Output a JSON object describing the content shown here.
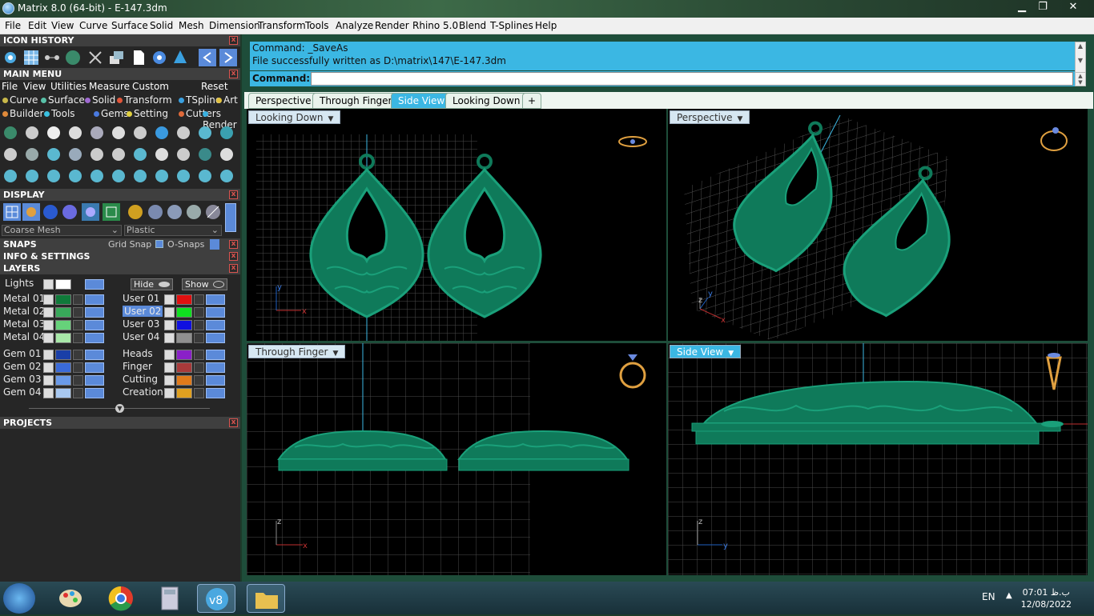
{
  "window": {
    "title": "Matrix 8.0 (64-bit) - E-147.3dm",
    "min": "▁",
    "max": "❐",
    "close": "✕"
  },
  "menubar": [
    "File",
    "Edit",
    "View",
    "Curve",
    "Surface",
    "Solid",
    "Mesh",
    "Dimension",
    "Transform",
    "Tools",
    "Analyze",
    "Render",
    "Rhino 5.0",
    "Blend",
    "T-Splines",
    "Help"
  ],
  "panels": {
    "icon_history": "ICON HISTORY",
    "main_menu": "MAIN MENU",
    "display": "DISPLAY",
    "snaps": "SNAPS",
    "info": "INFO & SETTINGS",
    "layers": "LAYERS",
    "projects": "PROJECTS"
  },
  "main_menu_tabs": [
    "File",
    "View",
    "Utilities",
    "Measure",
    "Custom",
    "Reset"
  ],
  "categories_row1": [
    {
      "label": "Curve",
      "color": "#c8b84a"
    },
    {
      "label": "Surface",
      "color": "#58c0a8"
    },
    {
      "label": "Solid",
      "color": "#9f6ad1"
    },
    {
      "label": "Transform",
      "color": "#e0553a"
    },
    {
      "label": "TSpline",
      "color": "#3aa0e0"
    },
    {
      "label": "Art",
      "color": "#e0c040"
    }
  ],
  "categories_row2": [
    {
      "label": "Builder",
      "color": "#e08a3a"
    },
    {
      "label": "Tools",
      "color": "#3ac0e0"
    },
    {
      "label": "Gems",
      "color": "#4a7ae0"
    },
    {
      "label": "Setting",
      "color": "#e0d040"
    },
    {
      "label": "Cutters",
      "color": "#e06a3a"
    },
    {
      "label": "Render",
      "color": "#3ab0e0"
    }
  ],
  "display": {
    "mesh": "Coarse Mesh",
    "material": "Plastic"
  },
  "snaps": {
    "grid": "Grid Snap",
    "osnaps": "O-Snaps"
  },
  "layers": {
    "lights": "Lights",
    "hide": "Hide",
    "show": "Show",
    "left": [
      {
        "name": "Metal 01",
        "color": "#0f7a3a"
      },
      {
        "name": "Metal 02",
        "color": "#38a85a"
      },
      {
        "name": "Metal 03",
        "color": "#66d27a"
      },
      {
        "name": "Metal 04",
        "color": "#a8e8a8"
      },
      {
        "name": "Gem 01",
        "color": "#1a3fa8"
      },
      {
        "name": "Gem 02",
        "color": "#3a6ad8"
      },
      {
        "name": "Gem 03",
        "color": "#6a9ae8"
      },
      {
        "name": "Gem 04",
        "color": "#a8c8f0"
      }
    ],
    "right": [
      {
        "name": "User 01",
        "color": "#e01010"
      },
      {
        "name": "User 02",
        "color": "#10e020"
      },
      {
        "name": "User 03",
        "color": "#1010e0"
      },
      {
        "name": "User 04",
        "color": "#909090"
      },
      {
        "name": "Heads",
        "color": "#8a20c8"
      },
      {
        "name": "Finger",
        "color": "#a83a3a"
      },
      {
        "name": "Cutting",
        "color": "#e07a1a"
      },
      {
        "name": "Creation",
        "color": "#e0a020"
      }
    ]
  },
  "command": {
    "line1": "Command: _SaveAs",
    "line2": "File successfully written as D:\\matrix\\147\\E-147.3dm",
    "prompt": "Command:",
    "input": ""
  },
  "viewport_tabs": [
    "Perspective",
    "Through Finger",
    "Side View",
    "Looking Down",
    "+"
  ],
  "viewports": {
    "top_left": "Looking Down",
    "top_right": "Perspective",
    "bottom_left": "Through Finger",
    "bottom_right": "Side View"
  },
  "axes": {
    "x": "x",
    "y": "y",
    "z": "z"
  },
  "taskbar": {
    "lang": "EN",
    "time": "07:01 ب.ظ",
    "date": "12/08/2022"
  },
  "colors": {
    "accent": "#3bb7e3",
    "model": "#0f7a5a",
    "grid": "#555555"
  }
}
